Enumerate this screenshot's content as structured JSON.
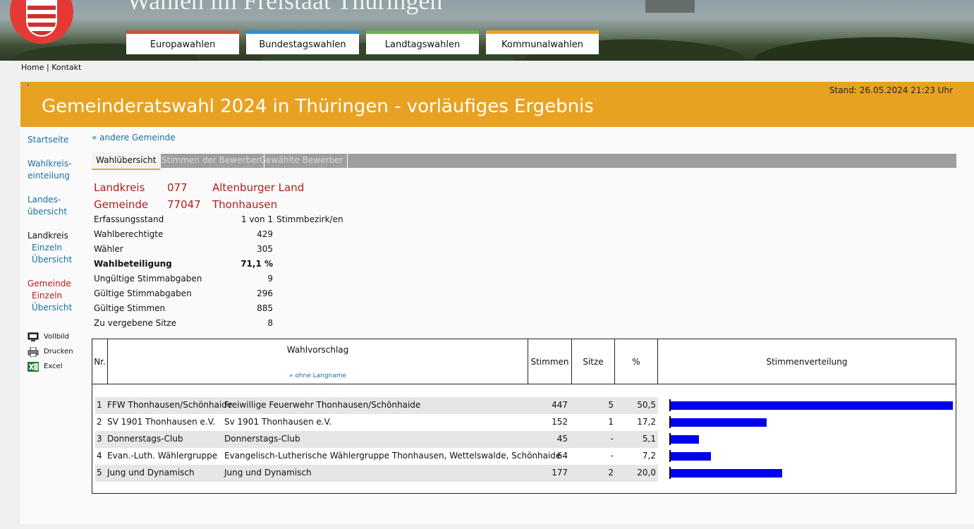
{
  "header": {
    "site_title": "Wahlen im Freistaat Thüringen",
    "nav_tabs": [
      {
        "label": "Europawahlen",
        "color": "#c9543a"
      },
      {
        "label": "Bundestagswahlen",
        "color": "#2f8ed8"
      },
      {
        "label": "Landtagswahlen",
        "color": "#6ab04c"
      },
      {
        "label": "Kommunalwahlen",
        "color": "#e8a222"
      }
    ]
  },
  "breadcrumb": {
    "home": "Home",
    "sep": "|",
    "contact": "Kontakt"
  },
  "title_bar": {
    "tick": "'",
    "title": "Gemeinderatswahl 2024 in Thüringen - vorläufiges Ergebnis",
    "stand": "Stand: 26.05.2024  21:23 Uhr"
  },
  "leftnav": {
    "startseite": "Startseite",
    "wahlkreis1": "Wahlkreis-",
    "wahlkreis2": "einteilung",
    "landes1": "Landes-",
    "landes2": "übersicht",
    "landkreis": "Landkreis",
    "lk_einzeln": "Einzeln",
    "lk_uebersicht": "Übersicht",
    "gemeinde": "Gemeinde",
    "gm_einzeln": "Einzeln",
    "gm_uebersicht": "Übersicht",
    "tools": [
      {
        "label": "Vollbild",
        "icon": "monitor-icon"
      },
      {
        "label": "Drucken",
        "icon": "printer-icon"
      },
      {
        "label": "Excel",
        "icon": "excel-icon"
      }
    ]
  },
  "content": {
    "other_muni": "« andere Gemeinde",
    "tabs": [
      "Wahlübersicht",
      "Stimmen der Bewerber",
      "Gewählte Bewerber"
    ],
    "landkreis": {
      "label": "Landkreis",
      "code": "077",
      "name": "Altenburger Land"
    },
    "gemeinde": {
      "label": "Gemeinde",
      "code": "77047",
      "name": "Thonhausen"
    },
    "stats": [
      {
        "label": "Erfassungsstand",
        "value": "1 von 1",
        "suffix": "Stimmbezirk/en"
      },
      {
        "label": "Wahlberechtigte",
        "value": "429",
        "suffix": ""
      },
      {
        "label": "Wähler",
        "value": "305",
        "suffix": ""
      },
      {
        "label": "Wahlbeteiligung",
        "value": "71,1  %",
        "suffix": ""
      },
      {
        "label": "Ungültige Stimmabgaben",
        "value": "9",
        "suffix": ""
      },
      {
        "label": "Gültige Stimmabgaben",
        "value": "296",
        "suffix": ""
      },
      {
        "label": "Gültige Stimmen",
        "value": "885",
        "suffix": ""
      },
      {
        "label": "Zu vergebene Sitze",
        "value": "8",
        "suffix": ""
      }
    ]
  },
  "results": {
    "headers": {
      "nr": "Nr.",
      "wahlvorschlag": "Wahlvorschlag",
      "ohne_langname": "» ohne Langname",
      "stimmen": "Stimmen",
      "sitze": "Sitze",
      "pct": "%",
      "verteilung": "Stimmenverteilung"
    },
    "rows": [
      {
        "nr": "1",
        "short": "FFW Thonhausen/Schönhaide",
        "long": "Freiwillige Feuerwehr Thonhausen/Schönhaide",
        "stimmen": "447",
        "sitze": "5",
        "pct": "50,5",
        "share": 50.5
      },
      {
        "nr": "2",
        "short": "SV 1901 Thonhausen e.V.",
        "long": "Sv 1901 Thonhausen e.V.",
        "stimmen": "152",
        "sitze": "1",
        "pct": "17,2",
        "share": 17.2
      },
      {
        "nr": "3",
        "short": "Donnerstags-Club",
        "long": "Donnerstags-Club",
        "stimmen": "45",
        "sitze": "-",
        "pct": "5,1",
        "share": 5.1
      },
      {
        "nr": "4",
        "short": "Evan.-Luth. Wählergruppe",
        "long": "Evangelisch-Lutherische Wählergruppe Thonhausen, Wettelswalde, Schönhaide",
        "stimmen": "64",
        "sitze": "-",
        "pct": "7,2",
        "share": 7.2
      },
      {
        "nr": "5",
        "short": "Jung und Dynamisch",
        "long": "Jung und Dynamisch",
        "stimmen": "177",
        "sitze": "2",
        "pct": "20,0",
        "share": 20.0
      }
    ],
    "bar_color": "#0000ee"
  }
}
